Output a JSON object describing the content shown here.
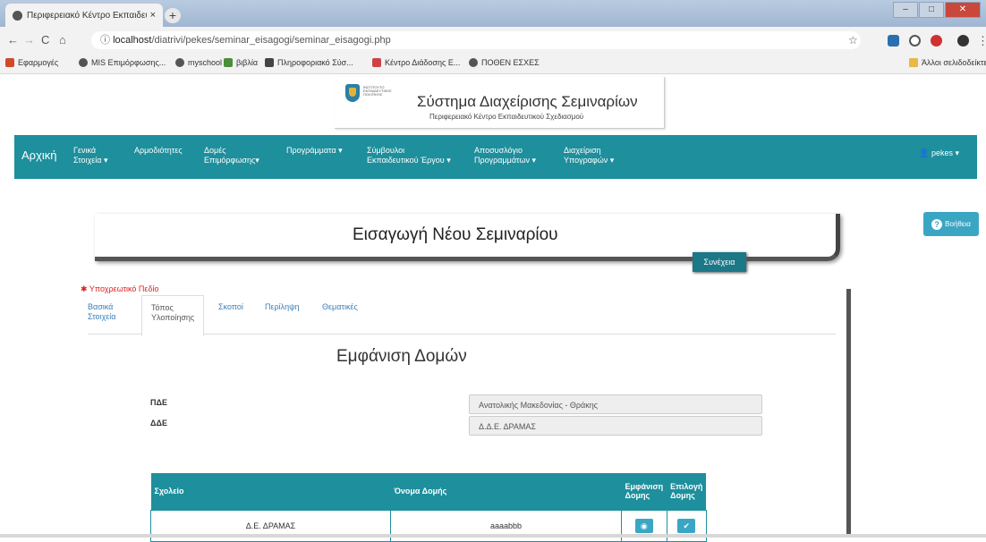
{
  "browser": {
    "tab_title": "Περιφερειακό Κέντρο Εκπαιδευ",
    "tab_close": "×",
    "new_tab": "+",
    "url_host": "localhost",
    "url_path": "/diatrivi/pekes/seminar_eisagogi/seminar_eisagogi.php",
    "url_info_icon": "ⓘ",
    "star": "☆",
    "bookmarks": [
      "Εφαρμογές",
      "MIS Επιμόρφωσης...",
      "myschool",
      "βιβλία",
      "Πληροφοριακό Σύσ...",
      "Κέντρο Διάδοσης Ε...",
      "ΠΟΘΕΝ ΕΣΧΕΣ"
    ],
    "other_bookmarks": "Άλλοι σελιδοδείκτες"
  },
  "header": {
    "logo_text": "ΙΝΣΤΙΤΟΥΤΟ ΕΚΠΑΙΔΕΥΤΙΚΗΣ ΠΟΛΙΤΙΚΗΣ",
    "title": "Σύστημα Διαχείρισης Σεμιναρίων",
    "subtitle": "Περιφερειακό Κέντρο Εκπαιδευτικού Σχεδιασμού"
  },
  "nav": {
    "brand": "Αρχική",
    "items": [
      {
        "line1": "Γενικά",
        "line2": "Στοιχεία ▾"
      },
      {
        "line1": "Αρμοδιότητες",
        "line2": ""
      },
      {
        "line1": "Δομές",
        "line2": "Επιμόρφωσης▾"
      },
      {
        "line1": "Προγράμματα ▾",
        "line2": ""
      },
      {
        "line1": "Σύμβουλοι",
        "line2": "Εκπαιδευτικού Έργου ▾"
      },
      {
        "line1": "Αποσυσλόγιο",
        "line2": "Προγραμμάτων ▾"
      },
      {
        "line1": "Διαχείριση",
        "line2": "Υπογραφών ▾"
      }
    ],
    "user": "pekes ▾",
    "user_icon": "👤"
  },
  "help_button": "Βοήθεια",
  "page_title": "Εισαγωγή Νέου Σεμιναρίου",
  "continue_button": "Συνέχεια",
  "required_note": "✱ Υποχρεωτικό Πεδίο",
  "tabs": [
    {
      "line1": "Βασικά",
      "line2": "Στοιχεία"
    },
    {
      "line1": "Τόπος",
      "line2": "Υλοποίησης"
    },
    {
      "line1": "Σκοποί",
      "line2": ""
    },
    {
      "line1": "Περίληψη",
      "line2": ""
    },
    {
      "line1": "Θεματικές",
      "line2": ""
    }
  ],
  "section_title": "Εμφάνιση Δομών",
  "fields": {
    "pde_label": "ΠΔΕ",
    "pde_value": "Ανατολικής Μακεδονίας - Θράκης",
    "dde_label": "ΔΔΕ",
    "dde_value": "Δ.Δ.Ε. ΔΡΑΜΑΣ"
  },
  "table": {
    "headers": [
      "Σχολείο",
      "Όνομα Δομής",
      "Εμφάνιση Δομης",
      "Επιλογή Δομης"
    ],
    "rows": [
      {
        "school": "Δ.Ε. ΔΡΑΜΑΣ",
        "name": "aaaabbb",
        "view_icon": "◉",
        "select_icon": "✔"
      }
    ]
  },
  "colors": {
    "accent": "#1e8f9c",
    "button": "#3aa6c4",
    "required": "#e02020"
  }
}
